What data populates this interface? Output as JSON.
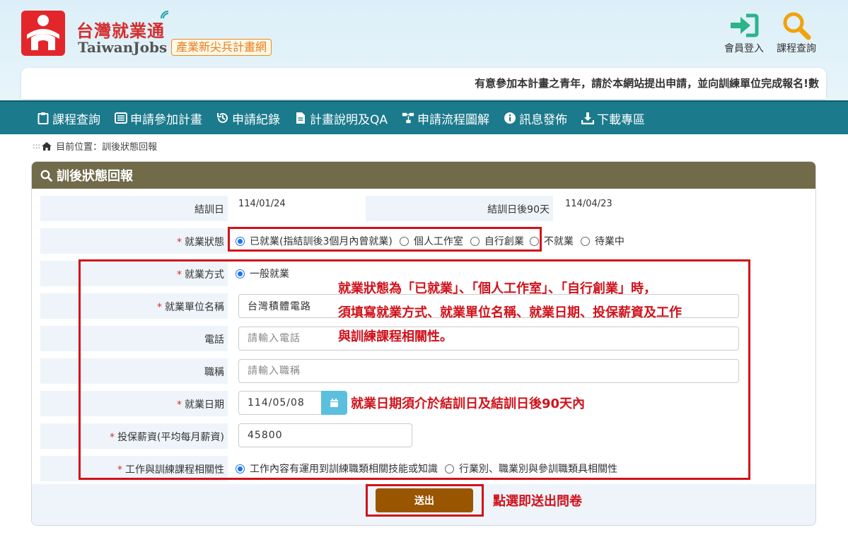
{
  "header": {
    "logo_cn": "台灣就業通",
    "logo_en": "TaiwanJobs",
    "logo_tag": "產業新尖兵計畫網",
    "login_label": "會員登入",
    "course_search_label": "課程查詢",
    "marquee": "有意參加本計畫之青年，請於本網站提出申請，並向訓練單位完成報名!數"
  },
  "nav": {
    "items": [
      {
        "label": "課程查詢",
        "icon": "clipboard-icon"
      },
      {
        "label": "申請參加計畫",
        "icon": "list-icon"
      },
      {
        "label": "申請紀錄",
        "icon": "history-icon"
      },
      {
        "label": "計畫說明及QA",
        "icon": "document-icon"
      },
      {
        "label": "申請流程圖解",
        "icon": "flowchart-icon"
      },
      {
        "label": "訊息發佈",
        "icon": "info-icon"
      },
      {
        "label": "下載專區",
        "icon": "download-icon"
      }
    ]
  },
  "breadcrumb": {
    "dots": ":::",
    "text": "目前位置：訓後狀態回報"
  },
  "panel": {
    "title": "訓後狀態回報"
  },
  "form": {
    "end_date": {
      "label": "結訓日",
      "value": "114/01/24"
    },
    "end_plus90": {
      "label": "結訓日後90天",
      "value": "114/04/23"
    },
    "employment_status": {
      "label": "就業狀態",
      "options": [
        "已就業(指結訓後3個月內曾就業)",
        "個人工作室",
        "自行創業",
        "不就業",
        "待業中"
      ],
      "selected": 0
    },
    "employment_type": {
      "label": "就業方式",
      "options": [
        "一般就業"
      ],
      "selected": 0
    },
    "employer_name": {
      "label": "就業單位名稱",
      "value": "台灣積體電路"
    },
    "phone": {
      "label": "電話",
      "placeholder": "請輸入電話"
    },
    "job_title": {
      "label": "職稱",
      "placeholder": "請輸入職稱"
    },
    "employment_date": {
      "label": "就業日期",
      "value": "114/05/08"
    },
    "salary": {
      "label": "投保薪資(平均每月薪資)",
      "value": "45800"
    },
    "relevance": {
      "label": "工作與訓練課程相關性",
      "options": [
        "工作內容有運用到訓練職類相關技能或知識",
        "行業別、職業別與參訓職類具相關性"
      ],
      "selected": 0
    },
    "submit_label": "送出"
  },
  "annotations": {
    "note_1_line1": "就業狀態為「已就業」、「個人工作室」、「自行創業」時，",
    "note_1_line2": "須填寫就業方式、就業單位名稱、就業日期、投保薪資及工作",
    "note_1_line3": "與訓練課程相關性。",
    "note_2": "就業日期須介於結訓日及結訓日後90天內",
    "note_3": "點選即送出問卷"
  },
  "colors": {
    "nav_bg": "#1b7a8c",
    "panel_head": "#716b4a",
    "submit": "#9a5500",
    "annotation_red": "#d0121b",
    "login_icon": "#2bb38a",
    "search_icon": "#f0a30a"
  }
}
